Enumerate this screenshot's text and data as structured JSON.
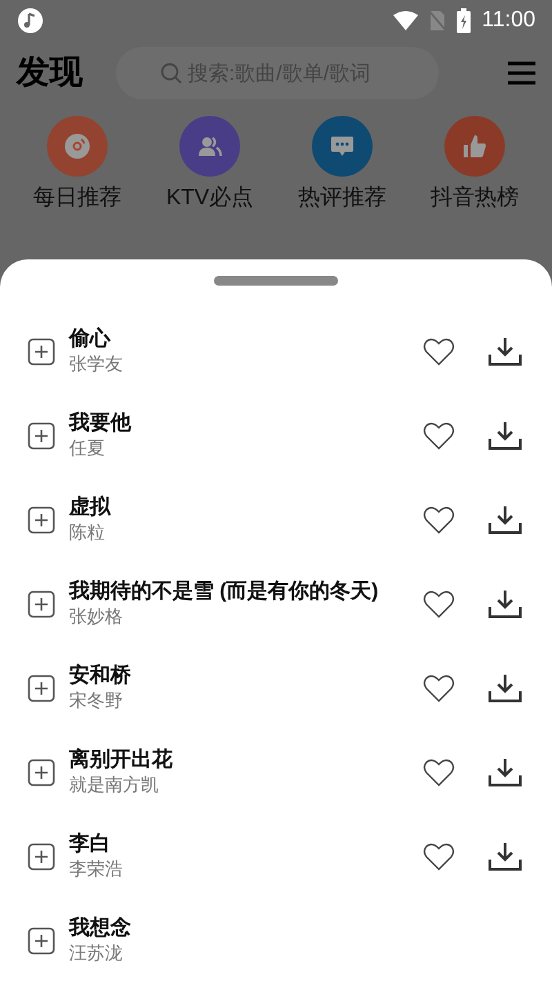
{
  "status_bar": {
    "time": "11:00"
  },
  "header": {
    "title": "发现",
    "search": {
      "placeholder": "搜索:歌曲/歌单/歌词"
    }
  },
  "shortcuts": [
    {
      "label": "每日推荐",
      "color": "#93432f",
      "kind": "disc"
    },
    {
      "label": "KTV必点",
      "color": "#483d86",
      "kind": "people"
    },
    {
      "label": "热评推荐",
      "color": "#0e4a72",
      "kind": "chat"
    },
    {
      "label": "抖音热榜",
      "color": "#8b3a28",
      "kind": "thumb"
    }
  ],
  "songs": [
    {
      "title": "偷心",
      "artist": "张学友",
      "kind": "full"
    },
    {
      "title": "我要他",
      "artist": "任夏",
      "kind": "full"
    },
    {
      "title": "虚拟",
      "artist": "陈粒",
      "kind": "full"
    },
    {
      "title": "我期待的不是雪 (而是有你的冬天)",
      "artist": "张妙格",
      "kind": "full"
    },
    {
      "title": "安和桥",
      "artist": "宋冬野",
      "kind": "full"
    },
    {
      "title": "离别开出花",
      "artist": "就是南方凯",
      "kind": "full"
    },
    {
      "title": "李白",
      "artist": "李荣浩",
      "kind": "full"
    },
    {
      "title": "我想念",
      "artist": "汪苏泷",
      "kind": "plain"
    }
  ]
}
